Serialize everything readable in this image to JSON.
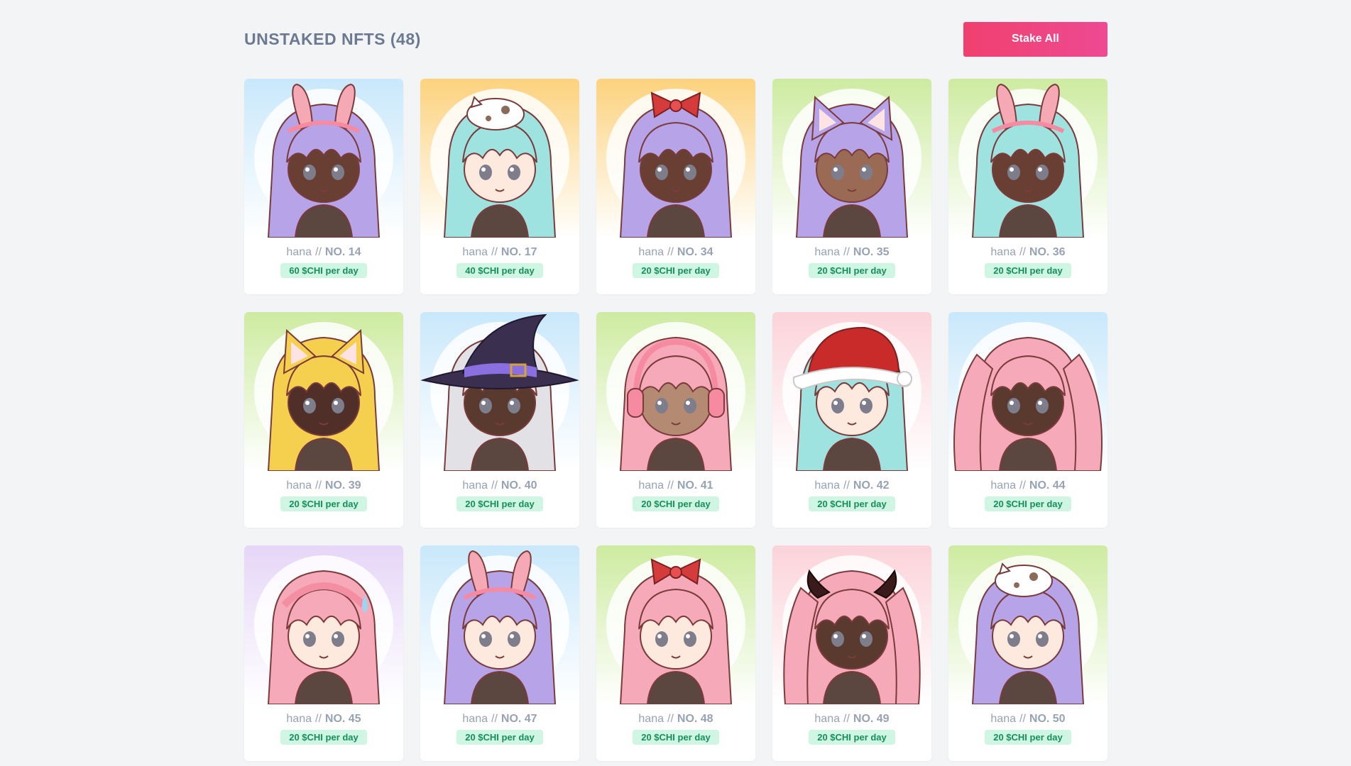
{
  "section": {
    "title": "UNSTAKED NFTS (48)",
    "stake_all_label": "Stake All"
  },
  "nfts": [
    {
      "collection": "hana",
      "sep": "//",
      "number": "NO. 14",
      "rate": "60 $CHI per day",
      "bg": "blue",
      "hair": "#b7a3e8",
      "skin": "#6a3f33",
      "accessory": "bunny-ears"
    },
    {
      "collection": "hana",
      "sep": "//",
      "number": "NO. 17",
      "rate": "40 $CHI per day",
      "bg": "orange",
      "hair": "#9fe3e0",
      "skin": "#fde9de",
      "accessory": "cat-on-head"
    },
    {
      "collection": "hana",
      "sep": "//",
      "number": "NO. 34",
      "rate": "20 $CHI per day",
      "bg": "orange",
      "hair": "#b7a3e8",
      "skin": "#6a3f33",
      "accessory": "red-bow"
    },
    {
      "collection": "hana",
      "sep": "//",
      "number": "NO. 35",
      "rate": "20 $CHI per day",
      "bg": "green",
      "hair": "#b7a3e8",
      "skin": "#9a6a55",
      "accessory": "cat-ears"
    },
    {
      "collection": "hana",
      "sep": "//",
      "number": "NO. 36",
      "rate": "20 $CHI per day",
      "bg": "green",
      "hair": "#9fe3e0",
      "skin": "#6a3f33",
      "accessory": "bunny-ears"
    },
    {
      "collection": "hana",
      "sep": "//",
      "number": "NO. 39",
      "rate": "20 $CHI per day",
      "bg": "green",
      "hair": "#f5cf4e",
      "skin": "#4f2f27",
      "accessory": "fox-ears"
    },
    {
      "collection": "hana",
      "sep": "//",
      "number": "NO. 40",
      "rate": "20 $CHI per day",
      "bg": "blue",
      "hair": "#e2e2e6",
      "skin": "#5a3a2f",
      "accessory": "witch-hat"
    },
    {
      "collection": "hana",
      "sep": "//",
      "number": "NO. 41",
      "rate": "20 $CHI per day",
      "bg": "green",
      "hair": "#f6a9b8",
      "skin": "#b58a73",
      "accessory": "headphones"
    },
    {
      "collection": "hana",
      "sep": "//",
      "number": "NO. 42",
      "rate": "20 $CHI per day",
      "bg": "pink",
      "hair": "#9fe3e0",
      "skin": "#fde9de",
      "accessory": "santa-hat"
    },
    {
      "collection": "hana",
      "sep": "//",
      "number": "NO. 44",
      "rate": "20 $CHI per day",
      "bg": "blue",
      "hair": "#f6a9b8",
      "skin": "#5a3a2f",
      "accessory": "twintails"
    },
    {
      "collection": "hana",
      "sep": "//",
      "number": "NO. 45",
      "rate": "20 $CHI per day",
      "bg": "purple",
      "hair": "#f6a9b8",
      "skin": "#fde9de",
      "accessory": "braid"
    },
    {
      "collection": "hana",
      "sep": "//",
      "number": "NO. 47",
      "rate": "20 $CHI per day",
      "bg": "blue",
      "hair": "#b7a3e8",
      "skin": "#fde9de",
      "accessory": "bunny-ears"
    },
    {
      "collection": "hana",
      "sep": "//",
      "number": "NO. 48",
      "rate": "20 $CHI per day",
      "bg": "green",
      "hair": "#f6a9b8",
      "skin": "#fde9de",
      "accessory": "red-bow"
    },
    {
      "collection": "hana",
      "sep": "//",
      "number": "NO. 49",
      "rate": "20 $CHI per day",
      "bg": "pink",
      "hair": "#f6a9b8",
      "skin": "#5a3a2f",
      "accessory": "horns"
    },
    {
      "collection": "hana",
      "sep": "//",
      "number": "NO. 50",
      "rate": "20 $CHI per day",
      "bg": "green",
      "hair": "#b7a3e8",
      "skin": "#fde9de",
      "accessory": "cat-on-head"
    }
  ],
  "colors": {
    "bg_blue": [
      "#c9e8fb",
      "#ffffff"
    ],
    "bg_orange": [
      "#fcd27e",
      "#ffffff"
    ],
    "bg_green": [
      "#cdeba0",
      "#ffffff"
    ],
    "bg_pink": [
      "#fbd3da",
      "#ffffff"
    ],
    "bg_purple": [
      "#e6d6f7",
      "#ffffff"
    ],
    "button": "#f0406e",
    "rate_bg": "#cff5e3",
    "rate_text": "#178f5a"
  }
}
